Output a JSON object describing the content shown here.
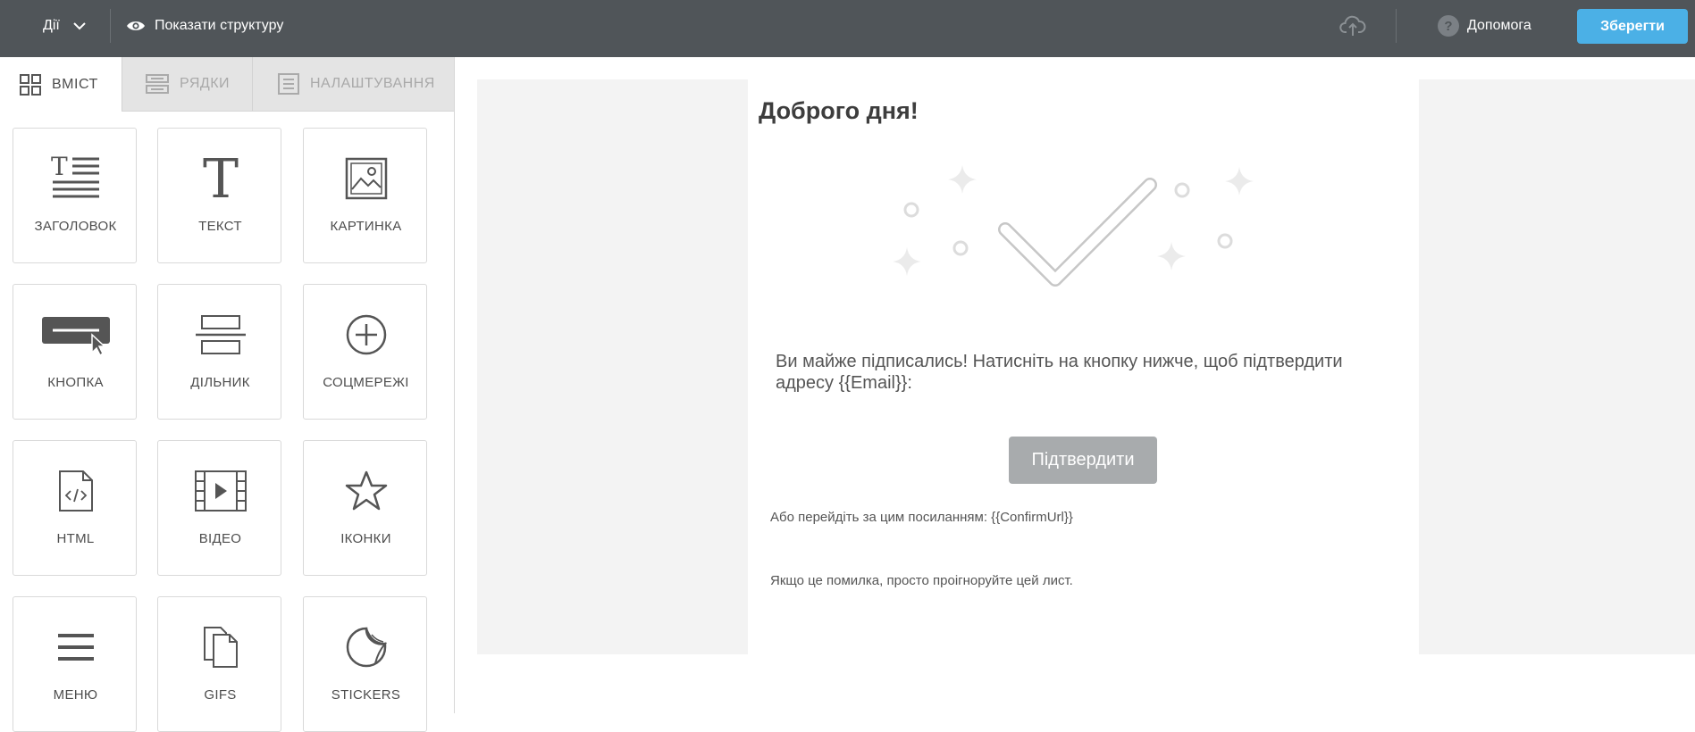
{
  "topbar": {
    "actions_label": "Дії",
    "show_structure_label": "Показати структуру",
    "help_label": "Допомога",
    "save_label": "Зберегти"
  },
  "sidebar": {
    "tabs": [
      {
        "label": "ВМІСТ",
        "active": true
      },
      {
        "label": "РЯДКИ",
        "active": false
      },
      {
        "label": "НАЛАШТУВАННЯ",
        "active": false
      }
    ],
    "tiles": [
      {
        "label": "ЗАГОЛОВОК",
        "icon": "heading-icon"
      },
      {
        "label": "ТЕКСТ",
        "icon": "text-icon"
      },
      {
        "label": "КАРТИНКА",
        "icon": "image-icon"
      },
      {
        "label": "КНОПКА",
        "icon": "button-icon"
      },
      {
        "label": "ДІЛЬНИК",
        "icon": "divider-icon"
      },
      {
        "label": "СОЦМЕРЕЖІ",
        "icon": "social-icon"
      },
      {
        "label": "HTML",
        "icon": "html-icon"
      },
      {
        "label": "ВІДЕО",
        "icon": "video-icon"
      },
      {
        "label": "ІКОНКИ",
        "icon": "star-icon"
      },
      {
        "label": "МЕНЮ",
        "icon": "menu-icon"
      },
      {
        "label": "GIFS",
        "icon": "gifs-icon"
      },
      {
        "label": "STICKERS",
        "icon": "sticker-icon"
      }
    ]
  },
  "email": {
    "greeting": "Доброго дня!",
    "intro": "Ви майже підписались! Натисніть на кнопку нижче, щоб підтвердити адресу {{Email}}:",
    "confirm_button": "Підтвердити",
    "link_line": "Або перейдіть за цим посиланням: {{ConfirmUrl}}",
    "ignore_line": "Якщо це помилка, просто проігноруйте цей лист."
  },
  "colors": {
    "topbar": "#505559",
    "save_button": "#4bb0e6",
    "confirm_button": "#a8abad",
    "panel_gray": "#f3f3f3"
  }
}
